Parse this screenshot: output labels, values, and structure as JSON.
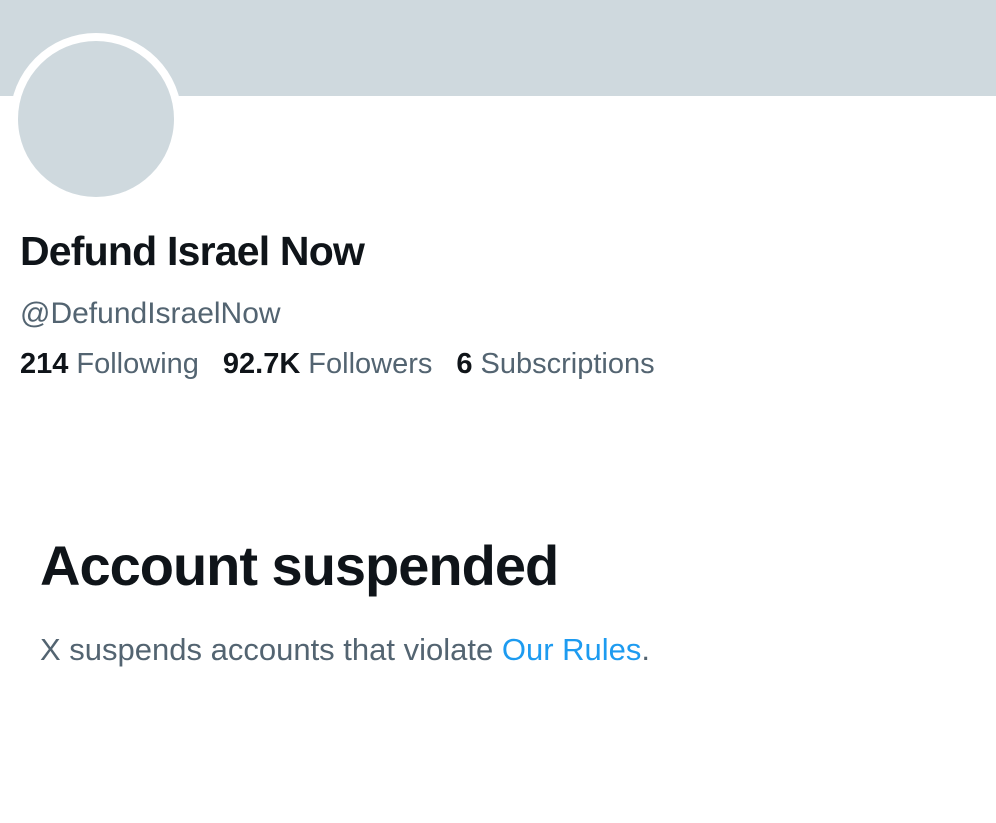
{
  "profile": {
    "display_name": "Defund Israel Now",
    "handle": "@DefundIsraelNow",
    "stats": [
      {
        "value": "214",
        "label": "Following"
      },
      {
        "value": "92.7K",
        "label": "Followers"
      },
      {
        "value": "6",
        "label": "Subscriptions"
      }
    ]
  },
  "suspension": {
    "title": "Account suspended",
    "description_prefix": "X suspends accounts that violate ",
    "rules_link": "Our Rules",
    "description_suffix": "."
  },
  "colors": {
    "banner": "#cfd9de",
    "avatar_placeholder": "#cfd9de",
    "primary_text": "#0f1419",
    "secondary_text": "#536471",
    "link": "#1d9bf0"
  }
}
